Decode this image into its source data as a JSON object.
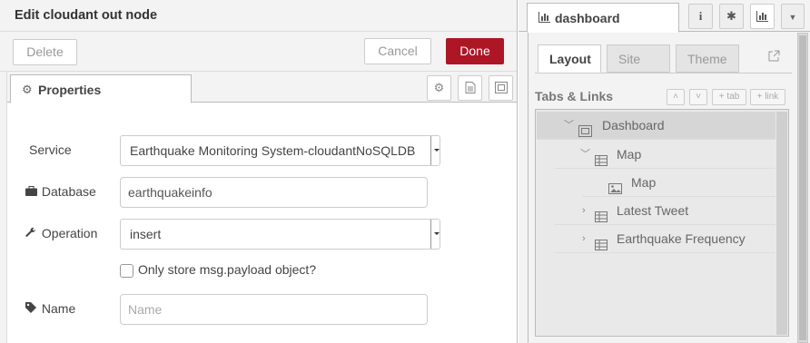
{
  "editor": {
    "title": "Edit cloudant out node",
    "buttons": {
      "delete": "Delete",
      "cancel": "Cancel",
      "done": "Done"
    },
    "tab": "Properties",
    "fields": {
      "service_label": "Service",
      "service_value": "Earthquake Monitoring System-cloudantNoSQLDB",
      "database_label": "Database",
      "database_value": "earthquakeinfo",
      "operation_label": "Operation",
      "operation_value": "insert",
      "payload_only_label": "Only store msg.payload object?",
      "name_label": "Name",
      "name_placeholder": "Name"
    }
  },
  "sidebar": {
    "tab": "dashboard",
    "subtabs": [
      "Layout",
      "Site",
      "Theme"
    ],
    "section_label": "Tabs & Links",
    "mini_buttons": {
      "tab": "tab",
      "link": "link"
    },
    "tree": [
      {
        "label": "Dashboard",
        "icon": "dashboard-icon",
        "expanded": true
      },
      {
        "label": "Map",
        "icon": "grid-icon",
        "expanded": true
      },
      {
        "label": "Map",
        "icon": "image-icon"
      },
      {
        "label": "Latest Tweet",
        "icon": "grid-icon",
        "expanded": false
      },
      {
        "label": "Earthquake Frequency",
        "icon": "grid-icon",
        "expanded": false
      }
    ]
  },
  "colors": {
    "done_button": "#ad1625",
    "panel_bg": "#f3f3f3",
    "tree_bg": "#e9e9e9"
  }
}
